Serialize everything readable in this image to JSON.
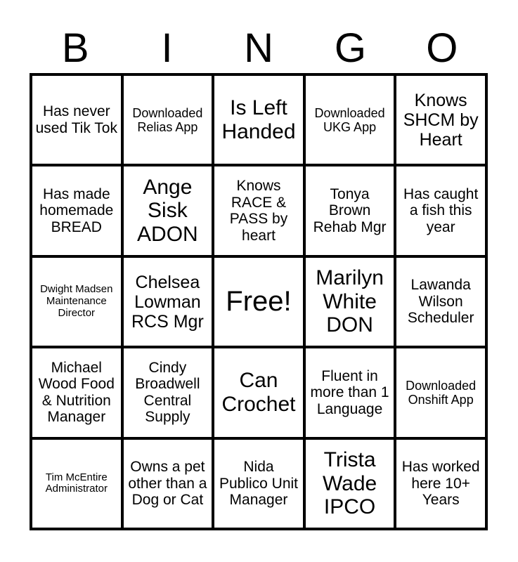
{
  "card": {
    "title": "BINGO",
    "header_letters": [
      "B",
      "I",
      "N",
      "G",
      "O"
    ],
    "grid_size": "5x5",
    "colors": {
      "border": "#000000",
      "background": "#ffffff",
      "text": "#000000"
    },
    "rows": [
      {
        "cells": [
          {
            "text": "Has never used Tik Tok",
            "size": "m"
          },
          {
            "text": "Downloaded Relias App",
            "size": "s"
          },
          {
            "text": "Is Left Handed",
            "size": "xl"
          },
          {
            "text": "Downloaded UKG App",
            "size": "s"
          },
          {
            "text": "Knows SHCM by Heart",
            "size": "l"
          }
        ]
      },
      {
        "cells": [
          {
            "text": "Has made homemade BREAD",
            "size": "m"
          },
          {
            "text": "Ange Sisk ADON",
            "size": "xl"
          },
          {
            "text": "Knows RACE & PASS by heart",
            "size": "m"
          },
          {
            "text": "Tonya Brown Rehab Mgr",
            "size": "m"
          },
          {
            "text": "Has caught a fish this year",
            "size": "m"
          }
        ]
      },
      {
        "cells": [
          {
            "text": "Dwight Madsen Maintenance Director",
            "size": "xs"
          },
          {
            "text": "Chelsea Lowman RCS Mgr",
            "size": "l"
          },
          {
            "text": "Free!",
            "size": "xxl"
          },
          {
            "text": "Marilyn White DON",
            "size": "xl"
          },
          {
            "text": "Lawanda Wilson Scheduler",
            "size": "m"
          }
        ]
      },
      {
        "cells": [
          {
            "text": "Michael Wood Food & Nutrition Manager",
            "size": "m"
          },
          {
            "text": "Cindy Broadwell Central Supply",
            "size": "m"
          },
          {
            "text": "Can Crochet",
            "size": "xl"
          },
          {
            "text": "Fluent in more than 1 Language",
            "size": "m"
          },
          {
            "text": "Downloaded Onshift App",
            "size": "s"
          }
        ]
      },
      {
        "cells": [
          {
            "text": "Tim McEntire Administrator",
            "size": "xs"
          },
          {
            "text": "Owns a pet other than a Dog or Cat",
            "size": "m"
          },
          {
            "text": "Nida Publico Unit Manager",
            "size": "m"
          },
          {
            "text": "Trista Wade IPCO",
            "size": "xl"
          },
          {
            "text": "Has worked here 10+ Years",
            "size": "m"
          }
        ]
      }
    ]
  }
}
